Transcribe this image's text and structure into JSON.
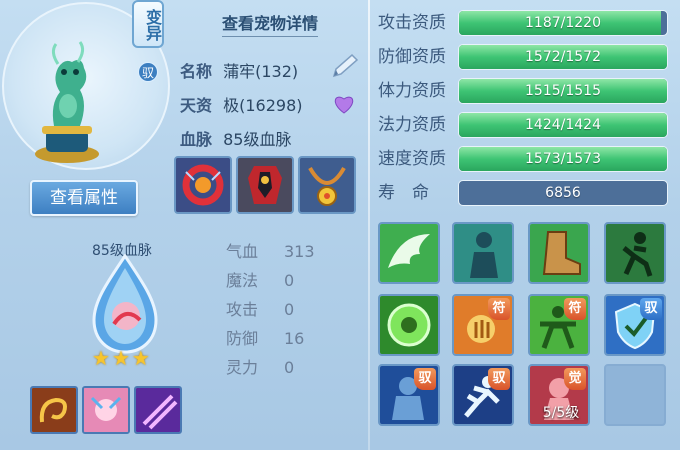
{
  "header": {
    "title": "查看宠物详情",
    "variant_badge": "变异",
    "yu_badge": "驭"
  },
  "pet": {
    "name_label": "名称",
    "name_value": "蒲牢(132)",
    "talent_label": "天资",
    "talent_value": "极(16298)",
    "bloodline_label": "血脉",
    "bloodline_value": "85级血脉"
  },
  "buttons": {
    "view_attributes": "查看属性"
  },
  "bloodline": {
    "title": "85级血脉",
    "stars": 3
  },
  "stats": [
    {
      "label": "气血",
      "value": "313"
    },
    {
      "label": "魔法",
      "value": "0"
    },
    {
      "label": "攻击",
      "value": "0"
    },
    {
      "label": "防御",
      "value": "16"
    },
    {
      "label": "灵力",
      "value": "0"
    }
  ],
  "aptitudes": [
    {
      "label": "攻击资质",
      "text": "1187/1220",
      "current": 1187,
      "max": 1220
    },
    {
      "label": "防御资质",
      "text": "1572/1572",
      "current": 1572,
      "max": 1572
    },
    {
      "label": "体力资质",
      "text": "1515/1515",
      "current": 1515,
      "max": 1515
    },
    {
      "label": "法力资质",
      "text": "1424/1424",
      "current": 1424,
      "max": 1424
    },
    {
      "label": "速度资质",
      "text": "1573/1573",
      "current": 1573,
      "max": 1573
    }
  ],
  "life": {
    "label": "寿　命",
    "value": "6856"
  },
  "skills": {
    "badges": {
      "fu": "符",
      "yu": "驭",
      "jue": "觉"
    },
    "level_text": "5/5级"
  },
  "colors": {
    "accent_green": "#3ec474",
    "bar_bg": "#4d6f99",
    "badge_orange": "#d9532a",
    "badge_blue": "#2d6fc6"
  }
}
